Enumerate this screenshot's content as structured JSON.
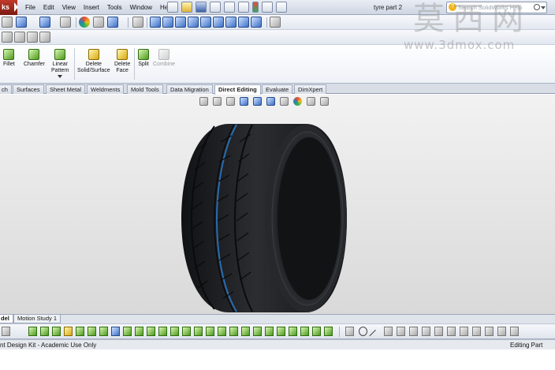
{
  "app": {
    "brand": "ks",
    "document_title": "tyre part 2"
  },
  "menu": [
    "File",
    "Edit",
    "View",
    "Insert",
    "Tools",
    "Window",
    "Help"
  ],
  "search": {
    "placeholder": "Search SolidWorks Help"
  },
  "command_manager": {
    "fillet": "Fillet",
    "chamfer": "Chamfer",
    "linear_pattern_1": "Linear",
    "linear_pattern_2": "Pattern",
    "delete_solid_1": "Delete",
    "delete_solid_2": "Solid/Surface",
    "delete_face_1": "Delete",
    "delete_face_2": "Face",
    "split": "Split",
    "combine": "Combine"
  },
  "tabs": [
    "ch",
    "Surfaces",
    "Sheet Metal",
    "Weldments",
    "Mold Tools",
    "Data Migration",
    "Direct Editing",
    "Evaluate",
    "DimXpert"
  ],
  "active_tab": "Direct Editing",
  "model_tabs": [
    "del",
    "Motion Study 1"
  ],
  "status": {
    "left": "nt Design Kit - Academic Use Only",
    "right": "Editing Part"
  },
  "watermark": {
    "cn": "莫西网",
    "url": "www.3dmox.com"
  },
  "colors": {
    "tire_body": "#1d1e21",
    "groove_accent": "#2a6cb0",
    "viewport_top": "#f2f2f2",
    "viewport_bottom": "#d9d9d9"
  }
}
